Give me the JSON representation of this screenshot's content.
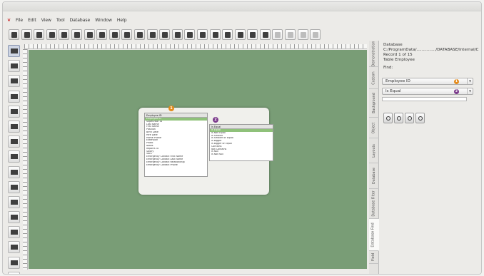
{
  "menu": [
    "File",
    "Edit",
    "View",
    "Tool",
    "Database",
    "Window",
    "Help"
  ],
  "toolbar": {
    "buttons": [
      "new-layout-icon",
      "open-icon",
      "save-icon",
      "database-icon",
      "print-icon",
      "text-icon",
      "line-icon",
      "table-icon",
      "image-icon",
      "tools-icon",
      "align-icon",
      "distribute-icon",
      "copy-icon",
      "paste-icon",
      "form-icon",
      "move-first-icon",
      "move-prev-icon",
      "move-next-icon",
      "move-last-icon",
      "add-record-icon",
      "delete-record-icon",
      "zoom-icon",
      "find-icon",
      "sort-icon",
      "refresh-icon"
    ]
  },
  "toolbox": [
    "pointer-icon",
    "line-tool-icon",
    "rectangle-tool-icon",
    "ellipse-tool-icon",
    "circle-tool-icon",
    "text-tool-icon",
    "field-tool-icon",
    "calendar-tool-icon",
    "table-tool-icon",
    "barcode-tool-icon",
    "image-tool-icon",
    "picture-tool-icon",
    "button-tool-icon",
    "photo-tool-icon",
    "edit-tool-icon",
    "round-tool-icon"
  ],
  "dialog": {
    "field_header": "Employee ID",
    "fields": [
      "Employee ID",
      "Supervisor ID",
      "Last Name",
      "First Name",
      "Position",
      "Birth Date",
      "Hire Date",
      "Home Phone",
      "Extension",
      "Photo",
      "Notes",
      "Reports To",
      "Salary",
      "Vacs",
      "Emergency Contact First Name",
      "Emergency Contact Last Name",
      "Emergency Contact Relationship",
      "Emergency Contact Phone"
    ],
    "operator_header": "Is Equal",
    "operators": [
      "Is Equal",
      "Is Not Equal",
      "Is Smaller",
      "Is Smaller or Equal",
      "Is Bigger",
      "Is Bigger or Equal",
      "Contains",
      "Not Contains",
      "Is Null",
      "Is Not Null"
    ],
    "badge1": "1",
    "badge2": "2"
  },
  "sidebar": {
    "tabs": [
      "Demonstration",
      "Custom",
      "Background",
      "Object",
      "Layouts",
      "Database",
      "Database Filter",
      "Database Find",
      "Field"
    ],
    "active_tab": "Database Find",
    "info_line1": "Database",
    "info_line2": "C:/ProgramData/.............../DATABASE/Internal/C",
    "info_line3": "Record 1 of 15",
    "info_line4": "Table Employee",
    "find_label": "Find:",
    "field_select": "Employee ID",
    "operator_select": "Is Equal",
    "find_value": "",
    "badge1": "1",
    "badge2": "2",
    "nav_buttons": [
      "find-first-icon",
      "find-previous-icon",
      "find-next-icon",
      "find-last-icon"
    ]
  },
  "colors": {
    "canvas": "#799d76",
    "highlight": "#8fc17a",
    "badge_orange": "#e38b1c",
    "badge_purple": "#7c3b8c"
  }
}
